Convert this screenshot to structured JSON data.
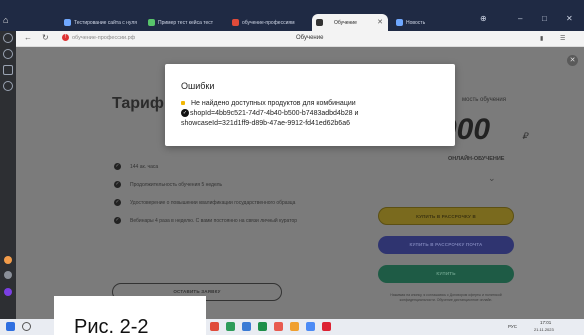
{
  "browser": {
    "tabs": [
      {
        "label": "Тестирование сайта с нуля",
        "active": false,
        "color": "#6fa8ff"
      },
      {
        "label": "Пример тест кейсa тест",
        "active": false,
        "color": "#58c46b"
      },
      {
        "label": "обучение-профессиям",
        "active": false,
        "color": "#e04b3a"
      },
      {
        "label": "Обучение",
        "active": true,
        "color": "#333333"
      },
      {
        "label": "Новость",
        "active": false,
        "color": "#6fa8ff"
      }
    ],
    "url": "обучение-профессии.рф",
    "page_title": "Обучение"
  },
  "page": {
    "tariff_title": "Тариф",
    "cost_label": "мость обучения",
    "big_price": "000",
    "currency": "₽",
    "online_label": "ОНЛАЙН-ОБУЧЕНИЕ",
    "features": [
      "144 ак. часа",
      "Продолжительность обучения 5 недель",
      "Удостоверение о повышении квалификации государственного образца",
      "Вебинары 4 раза в неделю. С вами постоянно на связи личный куратор"
    ],
    "buttons": {
      "installment": "КУПИТЬ В РАССРОЧКУ В",
      "installment_2": "КУПИТЬ В РАССРОЧКУ ПОЧТА",
      "buy": "КУПИТЬ",
      "leave_request": "ОСТАВИТЬ ЗАЯВКУ"
    },
    "fine_print": "Нажимая на кнопку, я соглашаюсь с Договором оферты и политикой конфиденциальности. Обучение дистанционное онлайн."
  },
  "modal": {
    "title": "Ошибки",
    "message_prefix": "Не найдено доступных продуктов для комбинации",
    "shop_id": "shopId=4bb9c521-74d7-4b40-b500-b7483adbd4b28 и",
    "showcase_id": "showcaseId=321d1ff9-d89b-47ae-9912-fd41ed62b6a6"
  },
  "caption": "Рис. 2-2",
  "taskbar": {
    "lang": "РУС",
    "time": "17:01",
    "date": "21.11.2023"
  }
}
